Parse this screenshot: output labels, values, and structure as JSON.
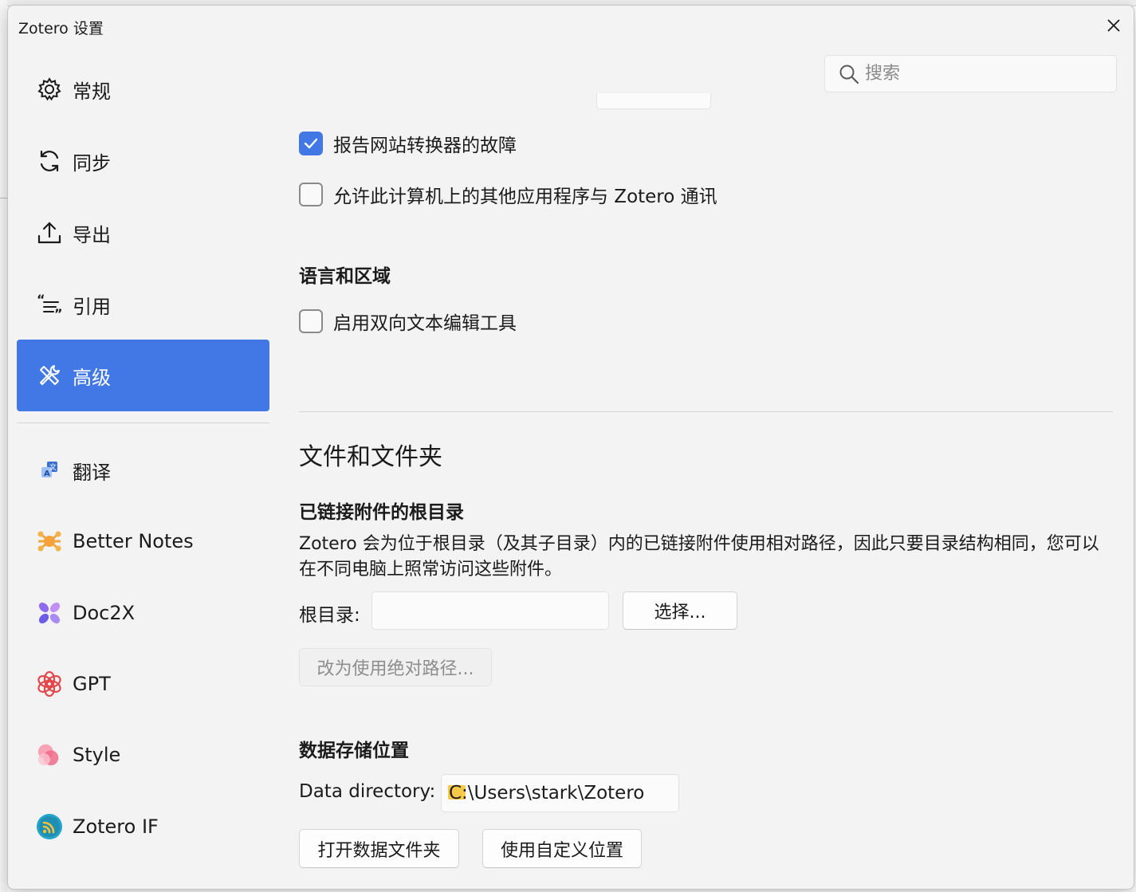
{
  "window": {
    "title": "Zotero 设置",
    "close_icon": "close-icon"
  },
  "search": {
    "placeholder": "搜索",
    "value": ""
  },
  "sidebar": {
    "items": [
      {
        "label": "常规",
        "icon": "gear-icon"
      },
      {
        "label": "同步",
        "icon": "sync-icon"
      },
      {
        "label": "导出",
        "icon": "export-icon"
      },
      {
        "label": "引用",
        "icon": "quote-icon"
      },
      {
        "label": "高级",
        "icon": "tools-icon",
        "active": true
      },
      {
        "label": "翻译",
        "icon": "translate-icon"
      },
      {
        "label": "Better Notes",
        "icon": "better-notes-icon"
      },
      {
        "label": "Doc2X",
        "icon": "doc2x-icon"
      },
      {
        "label": "GPT",
        "icon": "gpt-icon"
      },
      {
        "label": "Style",
        "icon": "style-icon"
      },
      {
        "label": "Zotero IF",
        "icon": "zotero-if-icon"
      }
    ]
  },
  "content": {
    "report_translator": {
      "label": "报告网站转换器的故障",
      "checked": true
    },
    "allow_other_apps": {
      "label": "允许此计算机上的其他应用程序与 Zotero 通讯",
      "checked": false
    },
    "lang_region": {
      "heading": "语言和区域",
      "bidi": {
        "label": "启用双向文本编辑工具",
        "checked": false
      }
    },
    "files": {
      "heading": "文件和文件夹",
      "linked_root": {
        "heading": "已链接附件的根目录",
        "description": "Zotero 会为位于根目录（及其子目录）内的已链接附件使用相对路径，因此只要目录结构相同，您可以在不同电脑上照常访问这些附件。",
        "root_label": "根目录:",
        "root_value": "",
        "choose_button": "选择...",
        "absolute_button": "改为使用绝对路径..."
      },
      "data_storage": {
        "heading": "数据存储位置",
        "dir_label": "Data directory:",
        "dir_value": "C:\\Users\\stark\\Zotero",
        "open_button": "打开数据文件夹",
        "custom_button": "使用自定义位置"
      }
    }
  },
  "colors": {
    "accent": "#4278e5",
    "window_bg": "#f3f3f3"
  }
}
